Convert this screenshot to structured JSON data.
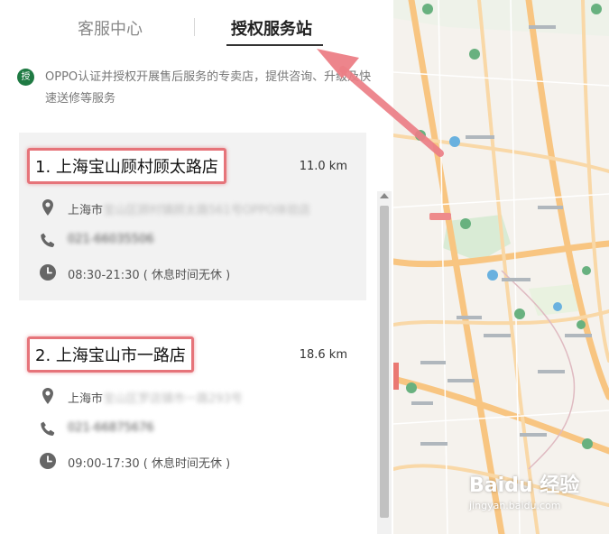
{
  "tabs": {
    "service_center": "客服中心",
    "authorized": "授权服务站"
  },
  "notice": {
    "badge": "授",
    "text": "OPPO认证并授权开展售后服务的专卖店，提供咨询、升级及快速送修等服务"
  },
  "stores": [
    {
      "name": "1. 上海宝山顾村顾太路店",
      "distance": "11.0 km",
      "city": "上海市",
      "address": "宝山区顾村镇顾太路561号OPPO体验店",
      "phone": "021-66035506",
      "hours": "08:30-21:30 ( 休息时间无休 )"
    },
    {
      "name": "2. 上海宝山市一路店",
      "distance": "18.6 km",
      "city": "上海市",
      "address": "宝山区罗店镇市一路293号",
      "phone": "021-66875676",
      "hours": "09:00-17:30 ( 休息时间无休 )"
    }
  ],
  "watermark": {
    "main": "Baidu 经验",
    "sub": "jingyan.baidu.com"
  },
  "colors": {
    "accent_green": "#1f7a43",
    "highlight_red": "#e6747a",
    "arrow": "#ec7e86",
    "map_road": "#f6b55e",
    "map_bg": "#f2efe8"
  }
}
